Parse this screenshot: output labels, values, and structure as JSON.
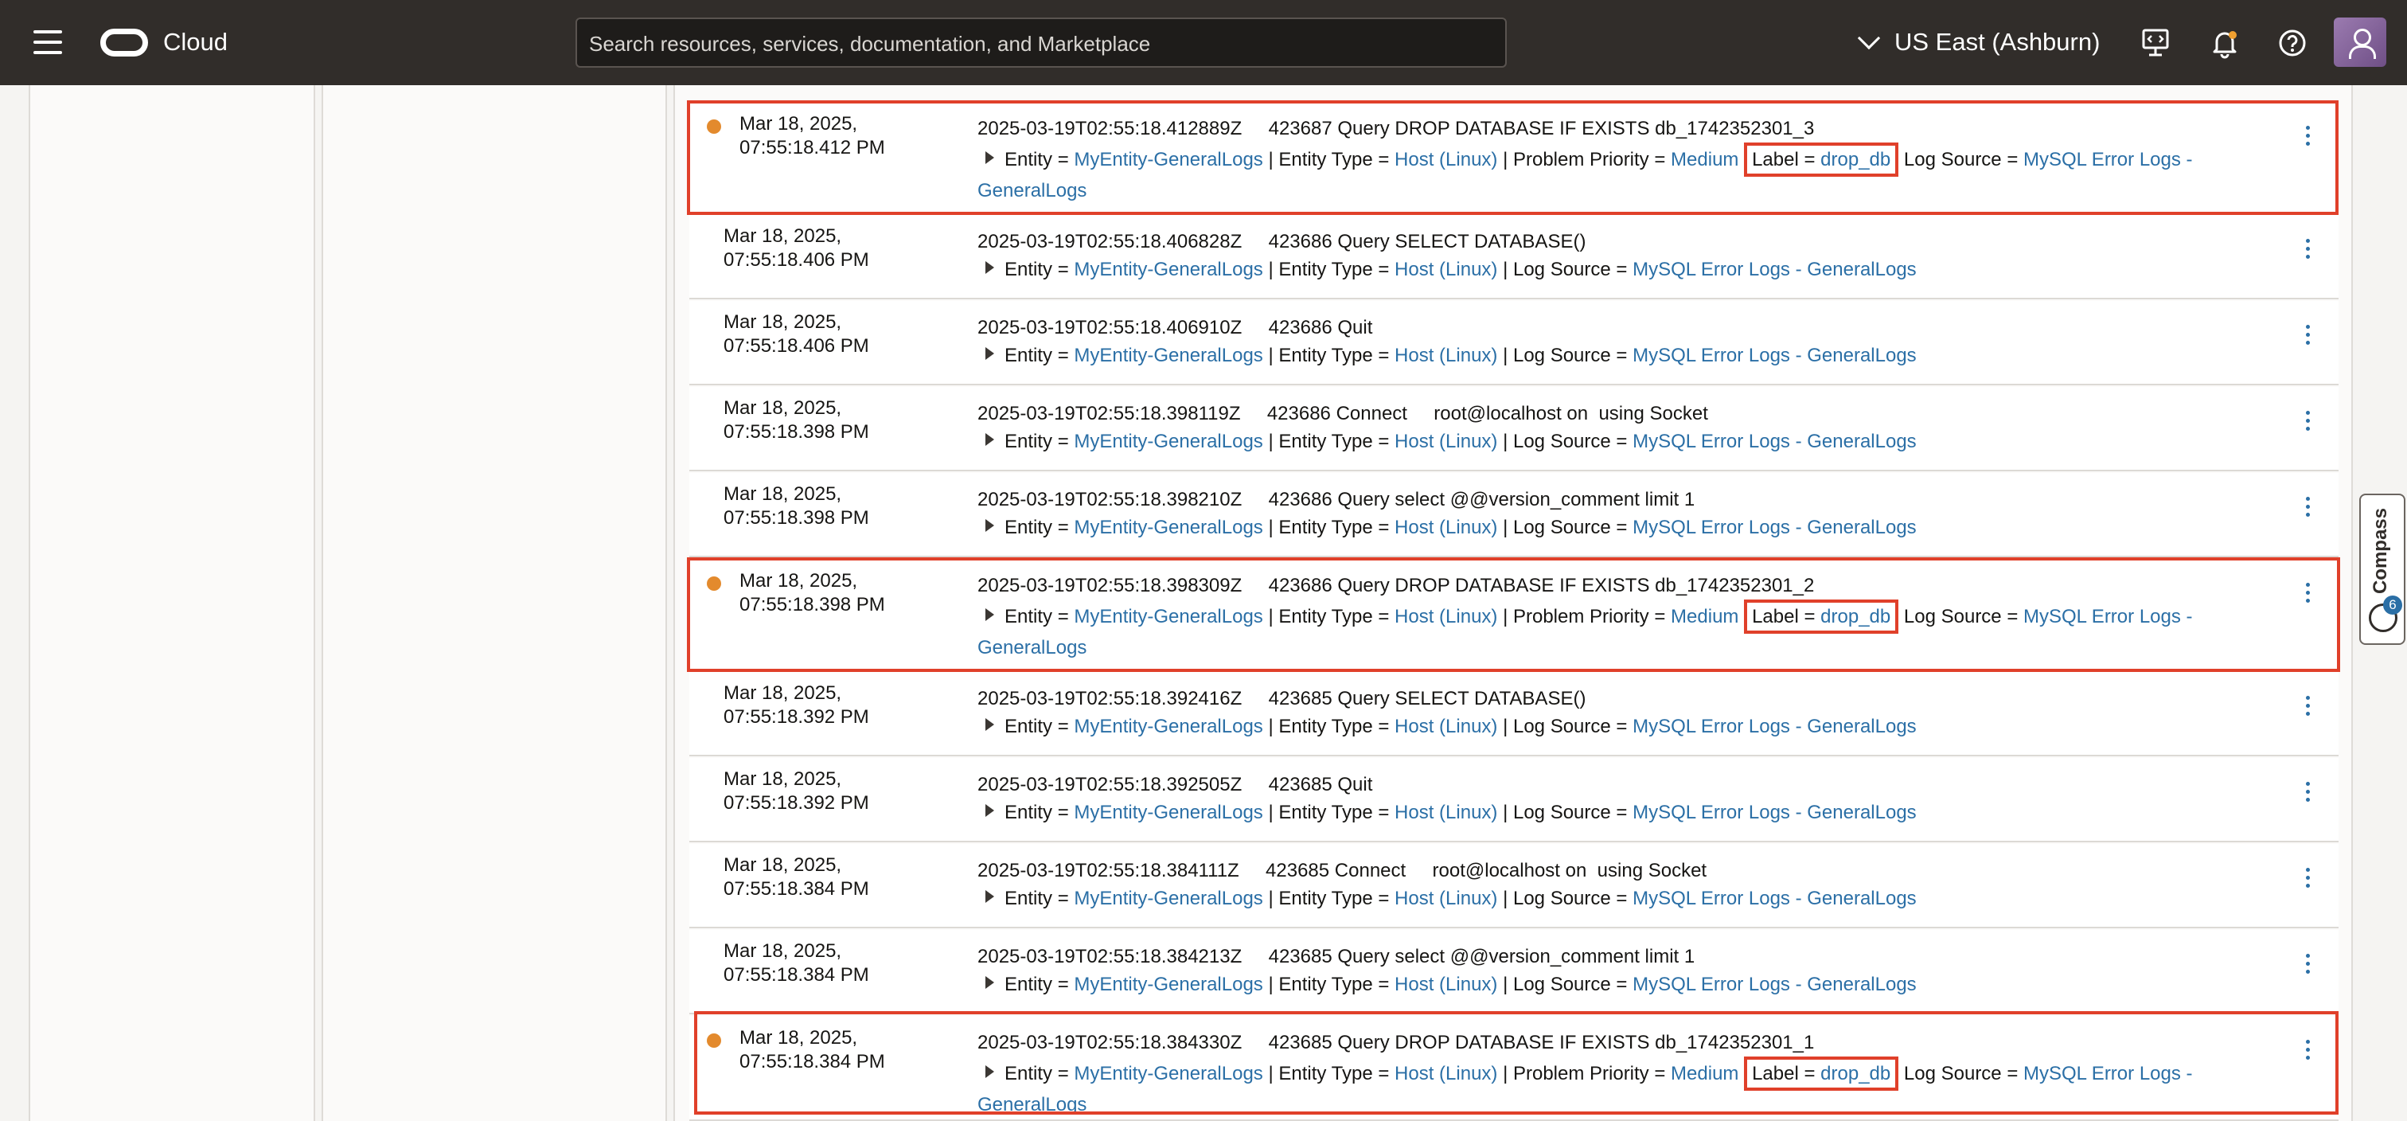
{
  "header": {
    "brand": "Cloud",
    "search_placeholder": "Search resources, services, documentation, and Marketplace",
    "region": "US East (Ashburn)"
  },
  "compass": {
    "label": "Compass",
    "badge": "6"
  },
  "colors": {
    "highlight": "#e0402a",
    "link": "#2b6fa6",
    "indicator": "#e38a2d"
  },
  "rows": [
    {
      "date": "Mar 18, 2025,",
      "time": "07:55:18.412 PM",
      "message": "2025-03-19T02:55:18.412889Z     423687 Query DROP DATABASE IF EXISTS db_1742352301_3",
      "entity": "MyEntity-GeneralLogs",
      "entity_type": "Host (Linux)",
      "priority": "Medium",
      "label": "drop_db",
      "source_a": "MySQL Error",
      "source_b": "Logs - GeneralLogs"
    },
    {
      "date": "Mar 18, 2025,",
      "time": "07:55:18.406 PM",
      "message": "2025-03-19T02:55:18.406828Z     423686 Query SELECT DATABASE()",
      "entity": "MyEntity-GeneralLogs",
      "entity_type": "Host (Linux)",
      "source": "MySQL Error Logs - GeneralLogs"
    },
    {
      "date": "Mar 18, 2025,",
      "time": "07:55:18.406 PM",
      "message": "2025-03-19T02:55:18.406910Z     423686 Quit",
      "entity": "MyEntity-GeneralLogs",
      "entity_type": "Host (Linux)",
      "source": "MySQL Error Logs - GeneralLogs"
    },
    {
      "date": "Mar 18, 2025,",
      "time": "07:55:18.398 PM",
      "message": "2025-03-19T02:55:18.398119Z     423686 Connect     root@localhost on  using Socket",
      "entity": "MyEntity-GeneralLogs",
      "entity_type": "Host (Linux)",
      "source": "MySQL Error Logs - GeneralLogs"
    },
    {
      "date": "Mar 18, 2025,",
      "time": "07:55:18.398 PM",
      "message": "2025-03-19T02:55:18.398210Z     423686 Query select @@version_comment limit 1",
      "entity": "MyEntity-GeneralLogs",
      "entity_type": "Host (Linux)",
      "source": "MySQL Error Logs - GeneralLogs"
    },
    {
      "date": "Mar 18, 2025,",
      "time": "07:55:18.398 PM",
      "message": "2025-03-19T02:55:18.398309Z     423686 Query DROP DATABASE IF EXISTS db_1742352301_2",
      "entity": "MyEntity-GeneralLogs",
      "entity_type": "Host (Linux)",
      "priority": "Medium",
      "label": "drop_db",
      "source_a": "MySQL Error",
      "source_b": "Logs - GeneralLogs"
    },
    {
      "date": "Mar 18, 2025,",
      "time": "07:55:18.392 PM",
      "message": "2025-03-19T02:55:18.392416Z     423685 Query SELECT DATABASE()",
      "entity": "MyEntity-GeneralLogs",
      "entity_type": "Host (Linux)",
      "source": "MySQL Error Logs - GeneralLogs"
    },
    {
      "date": "Mar 18, 2025,",
      "time": "07:55:18.392 PM",
      "message": "2025-03-19T02:55:18.392505Z     423685 Quit",
      "entity": "MyEntity-GeneralLogs",
      "entity_type": "Host (Linux)",
      "source": "MySQL Error Logs - GeneralLogs"
    },
    {
      "date": "Mar 18, 2025,",
      "time": "07:55:18.384 PM",
      "message": "2025-03-19T02:55:18.384111Z     423685 Connect     root@localhost on  using Socket",
      "entity": "MyEntity-GeneralLogs",
      "entity_type": "Host (Linux)",
      "source": "MySQL Error Logs - GeneralLogs"
    },
    {
      "date": "Mar 18, 2025,",
      "time": "07:55:18.384 PM",
      "message": "2025-03-19T02:55:18.384213Z     423685 Query select @@version_comment limit 1",
      "entity": "MyEntity-GeneralLogs",
      "entity_type": "Host (Linux)",
      "source": "MySQL Error Logs - GeneralLogs"
    },
    {
      "date": "Mar 18, 2025,",
      "time": "07:55:18.384 PM",
      "message": "2025-03-19T02:55:18.384330Z     423685 Query DROP DATABASE IF EXISTS db_1742352301_1",
      "entity": "MyEntity-GeneralLogs",
      "entity_type": "Host (Linux)",
      "priority": "Medium",
      "label": "drop_db",
      "source_a": "MySQL Error",
      "source_b": "Logs - GeneralLogs"
    }
  ]
}
